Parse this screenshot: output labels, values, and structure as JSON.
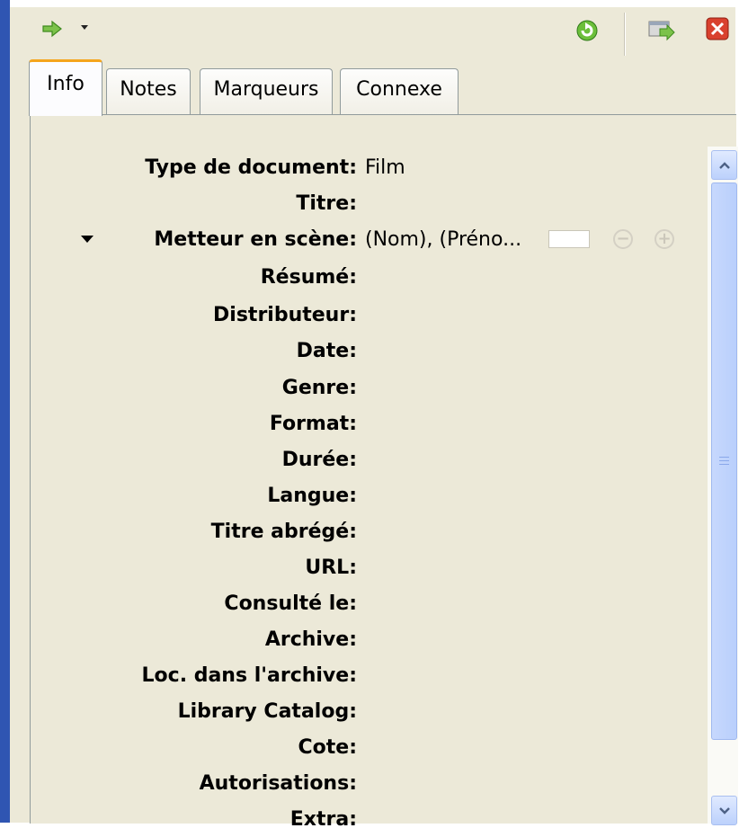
{
  "toolbar": {
    "go_icon": "green-right-arrow-icon",
    "sync_icon": "green-sync-icon",
    "close_icon": "red-close-icon"
  },
  "tabs": [
    {
      "label": "Info",
      "active": true
    },
    {
      "label": "Notes",
      "active": false
    },
    {
      "label": "Marqueurs",
      "active": false
    },
    {
      "label": "Connexe",
      "active": false
    }
  ],
  "fields": [
    {
      "label": "Type de document:",
      "value": "Film"
    },
    {
      "label": "Titre:",
      "value": ""
    },
    {
      "label": "Metteur en scène:",
      "value": "(Nom), (Préno..."
    },
    {
      "label": "Résumé:",
      "value": ""
    },
    {
      "label": "Distributeur:",
      "value": ""
    },
    {
      "label": "Date:",
      "value": ""
    },
    {
      "label": "Genre:",
      "value": ""
    },
    {
      "label": "Format:",
      "value": ""
    },
    {
      "label": "Durée:",
      "value": ""
    },
    {
      "label": "Langue:",
      "value": ""
    },
    {
      "label": "Titre abrégé:",
      "value": ""
    },
    {
      "label": "URL:",
      "value": ""
    },
    {
      "label": "Consulté le:",
      "value": ""
    },
    {
      "label": "Archive:",
      "value": ""
    },
    {
      "label": "Loc. dans l'archive:",
      "value": ""
    },
    {
      "label": "Library Catalog:",
      "value": ""
    },
    {
      "label": "Cote:",
      "value": ""
    },
    {
      "label": "Autorisations:",
      "value": ""
    },
    {
      "label": "Extra:",
      "value": ""
    }
  ],
  "creator_buttons": {
    "minus": "−",
    "plus": "+"
  },
  "colors": {
    "window_border": "#2f55b2",
    "pane_bg": "#ece9d8",
    "tab_highlight": "#f5a51c"
  }
}
